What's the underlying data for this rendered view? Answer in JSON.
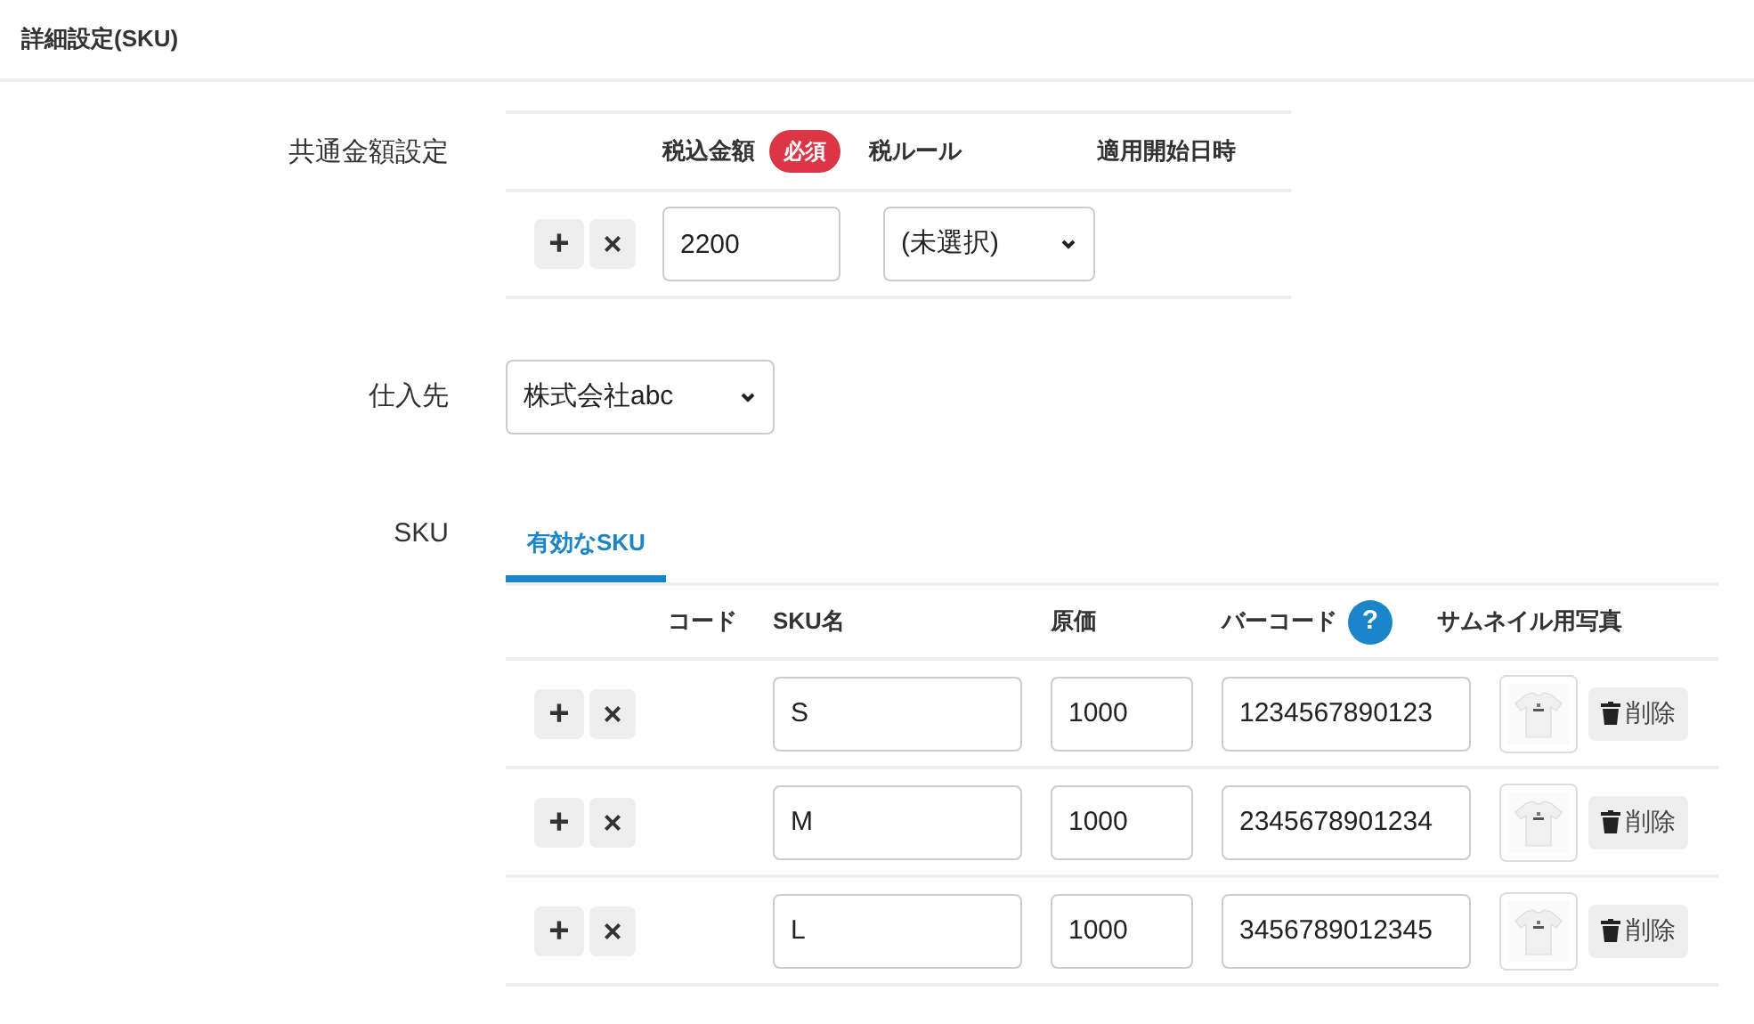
{
  "title": "詳細設定(SKU)",
  "price": {
    "label": "共通金額設定",
    "columns": [
      "税込金額",
      "税ルール",
      "適用開始日時"
    ],
    "required_badge": "必須",
    "add": "+",
    "remove": "×",
    "amount": "2200",
    "tax_rule": "(未選択)"
  },
  "supplier": {
    "label": "仕入先",
    "value": "株式会社abc"
  },
  "sku": {
    "label": "SKU",
    "tabs": [
      {
        "label": "有効なSKU",
        "selected": true
      }
    ],
    "columns": [
      "コード",
      "SKU名",
      "原価",
      "バーコード",
      "サムネイル用写真"
    ],
    "help": "?",
    "rows": [
      {
        "add": "+",
        "remove": "×",
        "name": "S",
        "cost": "1000",
        "barcode": "1234567890123",
        "delete": "削除"
      },
      {
        "add": "+",
        "remove": "×",
        "name": "M",
        "cost": "1000",
        "barcode": "2345678901234",
        "delete": "削除"
      },
      {
        "add": "+",
        "remove": "×",
        "name": "L",
        "cost": "1000",
        "barcode": "3456789012345",
        "delete": "削除"
      }
    ]
  }
}
